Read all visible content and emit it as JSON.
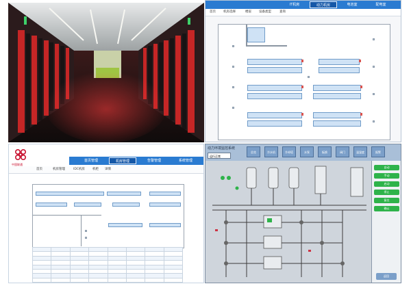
{
  "top_right": {
    "tabs": [
      {
        "label": "IT机房"
      },
      {
        "label": "动力机房"
      },
      {
        "label": "电池室"
      },
      {
        "label": "配电室"
      }
    ],
    "toolbar": [
      "首页",
      "机房选择",
      "楼层",
      "设备类型",
      "查询"
    ]
  },
  "bottom_left": {
    "logo_text": "中国联通",
    "nav": [
      {
        "label": "首页管理"
      },
      {
        "label": "机房管理"
      },
      {
        "label": "告警管理"
      },
      {
        "label": "系统管理"
      }
    ],
    "breadcrumb": [
      "首页",
      "机房管理",
      "IDC机房",
      "机柜",
      "详情"
    ],
    "table_rows": 9
  },
  "bottom_right": {
    "title": "动力环境监控系统",
    "field_value": "运行正常",
    "buttons": [
      "总览",
      "冷水机",
      "冷却塔",
      "水泵",
      "板换",
      "阀门",
      "温湿度",
      "报警"
    ],
    "side_buttons": [
      "自动",
      "手动",
      "启动",
      "停止",
      "复位",
      "确认"
    ],
    "exit_label": "返回"
  },
  "colors": {
    "accent": "#2a7bd1",
    "accent_dark": "#1558a8",
    "rack_fill": "#cfe2f5",
    "alarm": "#d9534f",
    "ok": "#2eb34a",
    "brand_red": "#c8102e"
  }
}
